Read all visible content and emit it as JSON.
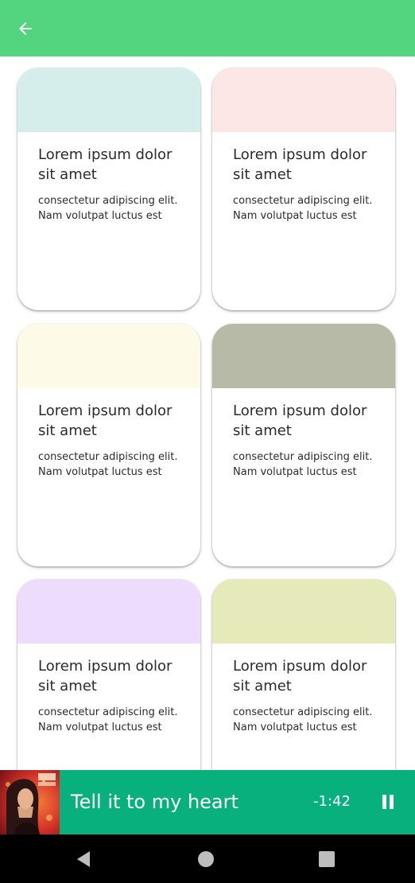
{
  "app_bar": {
    "background": "#52d57e",
    "back_icon": "arrow-back-icon"
  },
  "cards": [
    {
      "top_color": "#d5eeec",
      "title": "Lorem ipsum dolor sit amet",
      "description": "consectetur adipiscing elit. Nam volutpat luctus est"
    },
    {
      "top_color": "#fde6e6",
      "title": "Lorem ipsum dolor sit amet",
      "description": "consectetur adipiscing elit. Nam volutpat luctus est"
    },
    {
      "top_color": "#fdfbe8",
      "title": "Lorem ipsum dolor sit amet",
      "description": "consectetur adipiscing elit. Nam volutpat luctus est"
    },
    {
      "top_color": "#b6baa6",
      "title": "Lorem ipsum dolor sit amet",
      "description": "consectetur adipiscing elit. Nam volutpat luctus est"
    },
    {
      "top_color": "#eedcfc",
      "title": "Lorem ipsum dolor sit amet",
      "description": "consectetur adipiscing elit. Nam volutpat luctus est"
    },
    {
      "top_color": "#e6e9b9",
      "title": "Lorem ipsum dolor sit amet",
      "description": "consectetur adipiscing elit. Nam volutpat luctus est"
    }
  ],
  "player": {
    "background": "#07b07c",
    "song_title": "Tell it to my heart",
    "time_remaining": "-1:42",
    "control_icon": "pause-icon"
  },
  "system_nav": {
    "icons": [
      "back-triangle-icon",
      "home-circle-icon",
      "recents-square-icon"
    ]
  }
}
